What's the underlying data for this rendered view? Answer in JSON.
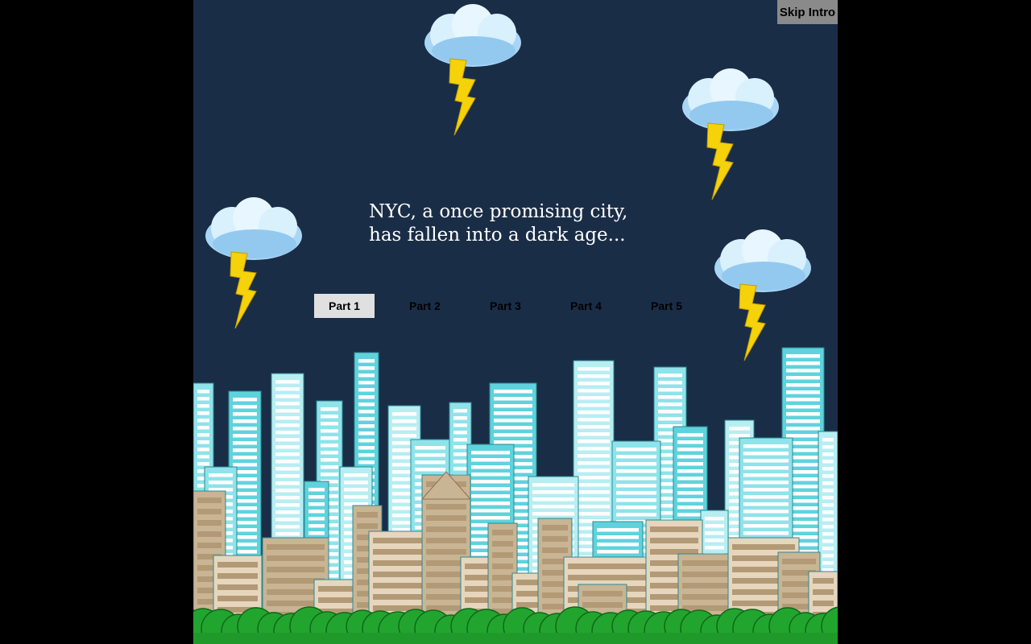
{
  "skip_intro_label": "Skip Intro",
  "story_text": "NYC, a once promising city, has fallen into a dark age...",
  "parts": [
    {
      "label": "Part 1",
      "active": true
    },
    {
      "label": "Part 2",
      "active": false
    },
    {
      "label": "Part 3",
      "active": false
    },
    {
      "label": "Part 4",
      "active": false
    },
    {
      "label": "Part 5",
      "active": false
    }
  ],
  "colors": {
    "sky": "#1a2d47",
    "cloud": "#bfe3f9",
    "lightning": "#f5d20a",
    "tower": "#5fd3dd",
    "brownstone": "#c9b494",
    "bushes": "#2db23a"
  },
  "icons": [
    "storm-cloud-icon",
    "lightning-bolt-icon"
  ]
}
